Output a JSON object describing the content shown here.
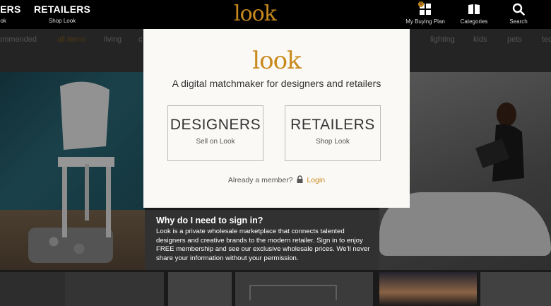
{
  "header": {
    "designers_short": "IERS",
    "designers_sub": "ook",
    "retailers_label": "RETAILERS",
    "retailers_sub": "Shop Look",
    "logo": "look",
    "buying_plan_label": "My Buying Plan",
    "buying_plan_badge": "0",
    "categories_label": "Categories",
    "search_label": "Search"
  },
  "nav": {
    "items": [
      "ommended",
      "all items",
      "living",
      "c",
      "lighting",
      "kids",
      "pets",
      "tec"
    ]
  },
  "modal": {
    "logo": "look",
    "tagline": "A digital matchmaker for designers and retailers",
    "designers_title": "DESIGNERS",
    "designers_sub": "Sell on Look",
    "retailers_title": "RETAILERS",
    "retailers_sub": "Shop Look",
    "member_text": "Already a member?",
    "login_label": "Login"
  },
  "info": {
    "heading": "Why do I need to sign in?",
    "body": "Look is a private wholesale marketplace that connects talented designers and creative brands to the modern retailer. Sign in to enjoy FREE membership and see our exclusive wholesale prices. We'll never share your information without your permission."
  },
  "colors": {
    "brand": "#c98a1d",
    "topbar": "#000000"
  }
}
